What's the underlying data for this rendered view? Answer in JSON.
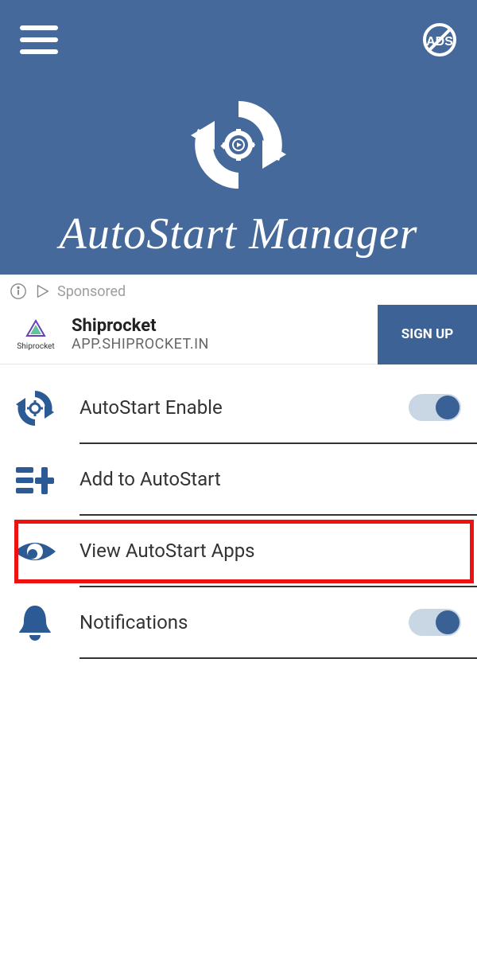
{
  "header": {
    "title": "AutoStart Manager"
  },
  "ad": {
    "sponsored_label": "Sponsored",
    "brand_name": "Shiprocket",
    "title": "Shiprocket",
    "subtitle": "APP.SHIPROCKET.IN",
    "cta": "SIGN UP"
  },
  "menu": {
    "items": [
      {
        "label": "AutoStart Enable",
        "toggle": true,
        "toggle_on": true
      },
      {
        "label": "Add to AutoStart",
        "toggle": false
      },
      {
        "label": "View AutoStart Apps",
        "toggle": false,
        "highlighted": true
      },
      {
        "label": "Notifications",
        "toggle": true,
        "toggle_on": true
      }
    ]
  },
  "colors": {
    "primary": "#45699a",
    "accent": "#3a6195"
  }
}
